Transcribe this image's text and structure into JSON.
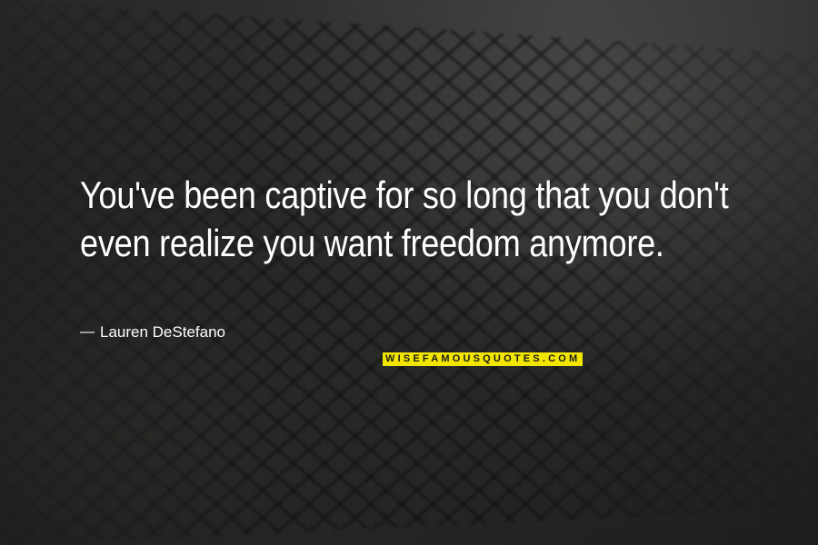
{
  "quote": {
    "text": "You've been captive for so long that you don't even realize you want freedom anymore."
  },
  "author": {
    "dash": "—",
    "name": "Lauren DeStefano"
  },
  "watermark": {
    "text": "WISEFAMOUSQUOTES.COM"
  },
  "colors": {
    "text": "#ffffff",
    "watermark_bg": "#f2e600",
    "background": "#2c2e2c"
  }
}
